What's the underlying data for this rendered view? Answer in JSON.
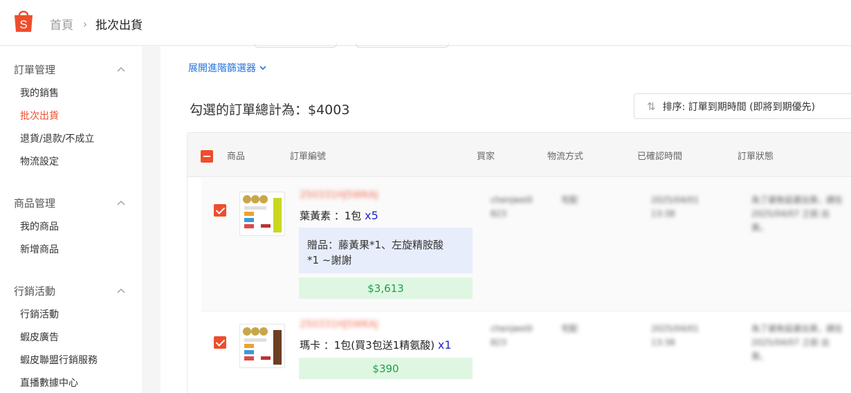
{
  "header": {
    "breadcrumb_home": "首頁",
    "breadcrumb_sep": "›",
    "breadcrumb_current": "批次出貨",
    "logo_letter": "S",
    "brand_color": "#ee4d2d"
  },
  "sidebar": {
    "sections": [
      {
        "title": "訂單管理",
        "items": [
          "我的銷售",
          "批次出貨",
          "退貨/退款/不成立",
          "物流設定"
        ]
      },
      {
        "title": "商品管理",
        "items": [
          "我的商品",
          "新增商品"
        ]
      },
      {
        "title": "行銷活動",
        "items": [
          "行銷活動",
          "蝦皮廣告",
          "蝦皮聯盟行銷服務",
          "直播數據中心"
        ]
      }
    ]
  },
  "main": {
    "expand_filter": "展開進階篩選器",
    "total_label": "勾選的訂單總計為：$4003",
    "sort_label": "排序: 訂單到期時間 (即將到期優先)",
    "columns": [
      "商品",
      "訂單編號",
      "買家",
      "物流方式",
      "已確認時間",
      "訂單狀態"
    ],
    "orders": [
      {
        "order_no": "250331HJ5WKAJ",
        "product": "葉黃素 ：1包",
        "qty": "x5",
        "gift_line1": "贈品：藤黃果*1、左旋精胺酸",
        "gift_line2": "*1 ~謝謝",
        "price": "$3,613",
        "buyer": "chenjwei0 823",
        "shipping": "宅配",
        "confirmed": "2025/04/01 13:38",
        "status": "為了避免延遲出貨，請在 2025/04/07 之前 出貨。"
      },
      {
        "order_no": "250331HJ5WKAJ",
        "product": "瑪卡 ：1包(買3包送1精氨酸)",
        "qty": "x1",
        "price": "$390",
        "buyer": "chenjwei0 823",
        "shipping": "宅配",
        "confirmed": "2025/04/01 13:38",
        "status": "為了避免延遲出貨，請在 2025/04/07 之前 出貨。"
      }
    ]
  }
}
